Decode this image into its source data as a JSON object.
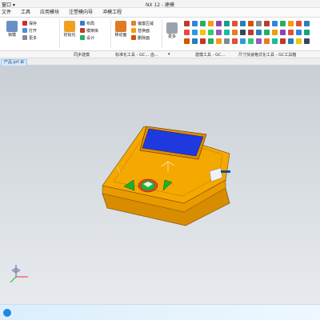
{
  "titlebar": {
    "window_menu": "窗口 ▾",
    "title": "NX 12 - 建模"
  },
  "menubar": {
    "tabs": [
      "文件",
      "工具",
      "应用模块",
      "注塑模向导",
      "冲模工程"
    ]
  },
  "ribbon": {
    "group1": {
      "big_label": "锁模",
      "items": [
        "保存",
        "打开",
        "更多"
      ]
    },
    "group2": {
      "big_label": "初始化",
      "items": [
        "布局",
        "模架库",
        "设计"
      ]
    },
    "group3": {
      "big_label": "移动面",
      "items": [
        "偏置区域",
        "替换面",
        "删除面"
      ]
    },
    "group4": {
      "more_label": "更多"
    },
    "more_label": "更多"
  },
  "cmdbar": {
    "items": [
      "同步建模",
      "标准化工具 - GC...",
      "齿...",
      "▾",
      "建模工具 - GC...",
      "尺寸快速格式化工具 - GC工具箱"
    ]
  },
  "tabbar": {
    "doc_tab": "产品.prt ⊠"
  },
  "colors": {
    "body": "#f5a800",
    "body_dark": "#c98000",
    "screen": "#1e3adf",
    "buttons_green": "#18b32b",
    "buttons_red": "#e01f1f",
    "accent": "#1e4f93"
  }
}
